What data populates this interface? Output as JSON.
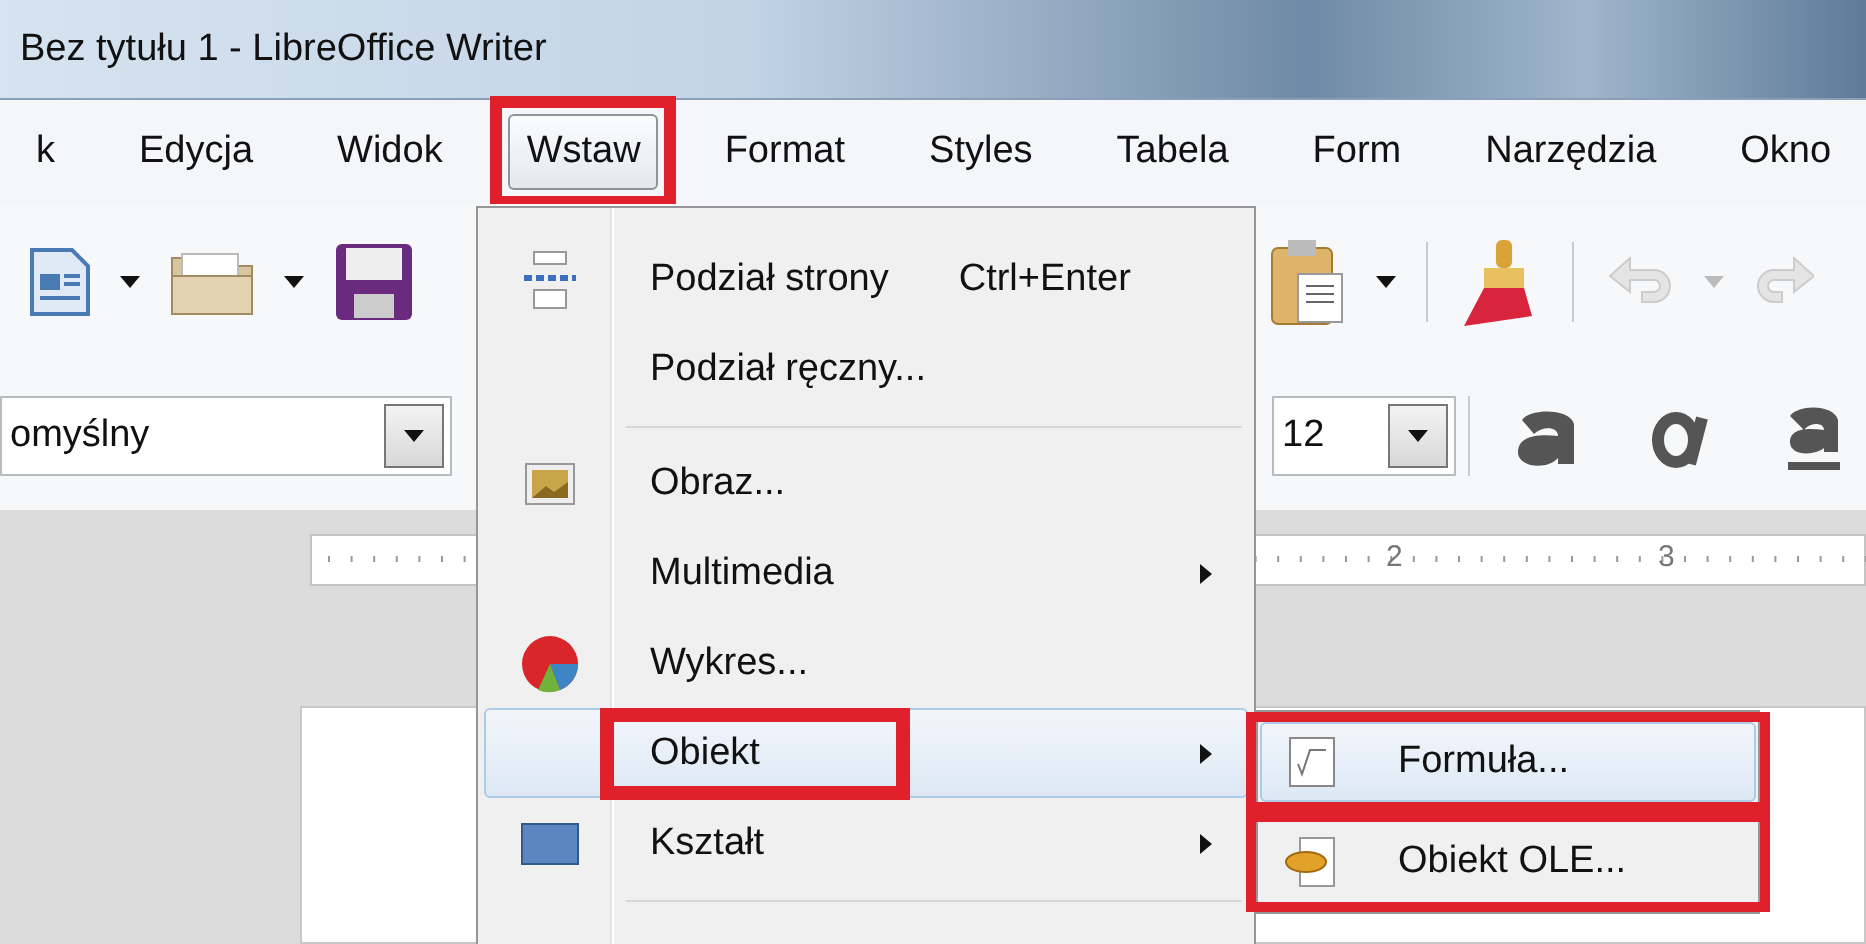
{
  "window": {
    "title": "Bez tytułu 1 - LibreOffice Writer"
  },
  "menu_bar": [
    {
      "label": "k",
      "selected": false,
      "annotated": false
    },
    {
      "label": "Edycja",
      "selected": false,
      "annotated": false
    },
    {
      "label": "Widok",
      "selected": false,
      "annotated": false
    },
    {
      "label": "Wstaw",
      "selected": true,
      "annotated": true
    },
    {
      "label": "Format",
      "selected": false,
      "annotated": false
    },
    {
      "label": "Styles",
      "selected": false,
      "annotated": false
    },
    {
      "label": "Tabela",
      "selected": false,
      "annotated": false
    },
    {
      "label": "Form",
      "selected": false,
      "annotated": false
    },
    {
      "label": "Narzędzia",
      "selected": false,
      "annotated": false
    },
    {
      "label": "Okno",
      "selected": false,
      "annotated": false
    }
  ],
  "toolbar": {
    "paragraph_style": "omyślny",
    "font_size": "12"
  },
  "ruler": {
    "labels": [
      "2",
      "3"
    ]
  },
  "insert_menu": {
    "items": [
      {
        "kind": "item",
        "label": "Podział strony",
        "shortcut": "Ctrl+Enter",
        "submenu": false,
        "selected": false,
        "annotated": false
      },
      {
        "kind": "item",
        "label": "Podział ręczny...",
        "submenu": false,
        "selected": false,
        "annotated": false
      },
      {
        "kind": "separator"
      },
      {
        "kind": "item",
        "label": "Obraz...",
        "submenu": false,
        "selected": false,
        "annotated": false
      },
      {
        "kind": "item",
        "label": "Multimedia",
        "submenu": true,
        "selected": false,
        "annotated": false
      },
      {
        "kind": "item",
        "label": "Wykres...",
        "submenu": false,
        "selected": false,
        "annotated": false
      },
      {
        "kind": "item",
        "label": "Obiekt",
        "submenu": true,
        "selected": true,
        "annotated": true
      },
      {
        "kind": "item",
        "label": "Kształt",
        "submenu": true,
        "selected": false,
        "annotated": false
      },
      {
        "kind": "separator"
      }
    ]
  },
  "object_submenu": {
    "items": [
      {
        "label": "Formuła...",
        "selected": true,
        "annotated": true
      },
      {
        "label": "Obiekt OLE...",
        "selected": false,
        "annotated": true
      }
    ]
  }
}
